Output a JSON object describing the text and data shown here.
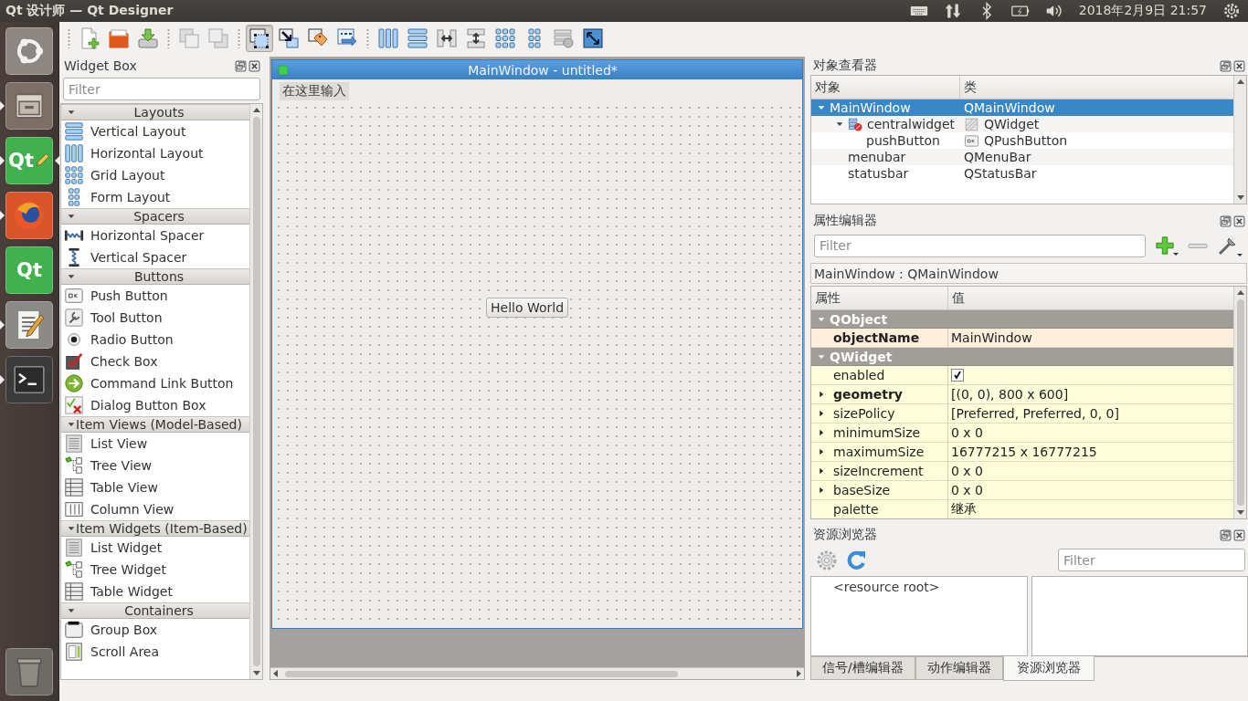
{
  "top_bar": {
    "title": "Qt 设计师 — Qt Designer",
    "clock": "2018年2月9日 21:57"
  },
  "launcher": [
    {
      "kind": "ubuntu",
      "running": false,
      "active": false
    },
    {
      "kind": "files",
      "running": true,
      "active": false
    },
    {
      "kind": "qt-designer",
      "label": "Qt",
      "running": true,
      "active": true
    },
    {
      "kind": "browser",
      "running": true,
      "active": false
    },
    {
      "kind": "qt-creator",
      "label": "Qt",
      "running": false,
      "active": false
    },
    {
      "kind": "editor",
      "running": true,
      "active": false
    },
    {
      "kind": "terminal",
      "running": true,
      "active": false
    },
    {
      "kind": "trash",
      "running": false,
      "active": false
    }
  ],
  "toolbar": {
    "groups": [
      {
        "tools": [
          {
            "kind": "new",
            "selected": false
          },
          {
            "kind": "open",
            "selected": false
          },
          {
            "kind": "save",
            "selected": false
          }
        ]
      },
      {
        "tools": [
          {
            "kind": "back",
            "selected": false
          },
          {
            "kind": "front",
            "selected": false
          }
        ]
      },
      {
        "tools": [
          {
            "kind": "select",
            "selected": true
          },
          {
            "kind": "signals",
            "selected": false
          },
          {
            "kind": "buddies",
            "selected": false
          },
          {
            "kind": "taborder",
            "selected": false
          }
        ]
      },
      {
        "tools": [
          {
            "kind": "hlayout",
            "selected": false
          },
          {
            "kind": "vlayout",
            "selected": false
          },
          {
            "kind": "hsplit",
            "selected": false
          },
          {
            "kind": "vsplit",
            "selected": false
          },
          {
            "kind": "grid",
            "selected": false
          },
          {
            "kind": "form",
            "selected": false
          },
          {
            "kind": "break",
            "selected": false
          },
          {
            "kind": "adjust",
            "selected": false
          }
        ]
      }
    ]
  },
  "widget_box": {
    "title": "Widget Box",
    "filter": {
      "placeholder": "Filter"
    },
    "categories": [
      {
        "name": "Layouts",
        "expanded": true,
        "items": [
          {
            "label": "Vertical Layout",
            "kind": "vlayout"
          },
          {
            "label": "Horizontal Layout",
            "kind": "hlayout"
          },
          {
            "label": "Grid Layout",
            "kind": "grid"
          },
          {
            "label": "Form Layout",
            "kind": "form"
          }
        ]
      },
      {
        "name": "Spacers",
        "expanded": true,
        "items": [
          {
            "label": "Horizontal Spacer",
            "kind": "hspacer"
          },
          {
            "label": "Vertical Spacer",
            "kind": "vspacer"
          }
        ]
      },
      {
        "name": "Buttons",
        "expanded": true,
        "items": [
          {
            "label": "Push Button",
            "kind": "push"
          },
          {
            "label": "Tool Button",
            "kind": "tool"
          },
          {
            "label": "Radio Button",
            "kind": "radio"
          },
          {
            "label": "Check Box",
            "kind": "check"
          },
          {
            "label": "Command Link Button",
            "kind": "command"
          },
          {
            "label": "Dialog Button Box",
            "kind": "dialog"
          }
        ]
      },
      {
        "name": "Item Views (Model-Based)",
        "expanded": true,
        "items": [
          {
            "label": "List View",
            "kind": "list"
          },
          {
            "label": "Tree View",
            "kind": "tree"
          },
          {
            "label": "Table View",
            "kind": "table"
          },
          {
            "label": "Column View",
            "kind": "column"
          }
        ]
      },
      {
        "name": "Item Widgets (Item-Based)",
        "expanded": true,
        "items": [
          {
            "label": "List Widget",
            "kind": "list"
          },
          {
            "label": "Tree Widget",
            "kind": "tree"
          },
          {
            "label": "Table Widget",
            "kind": "table"
          }
        ]
      },
      {
        "name": "Containers",
        "expanded": true,
        "items": [
          {
            "label": "Group Box",
            "kind": "group"
          },
          {
            "label": "Scroll Area",
            "kind": "scroll"
          }
        ]
      }
    ]
  },
  "form": {
    "title": "MainWindow - untitled*",
    "menu_placeholder": "在这里输入",
    "button": "Hello World"
  },
  "object_inspector": {
    "title": "对象查看器",
    "columns": [
      "对象",
      "类"
    ],
    "tree": [
      {
        "object": "MainWindow",
        "class": "QMainWindow",
        "selected": true,
        "expanded": true,
        "children": [
          {
            "object": "centralwidget",
            "class": "QWidget",
            "kind": "container",
            "selected": false,
            "expanded": true,
            "children": [
              {
                "object": "pushButton",
                "class": "QPushButton",
                "kind": "button",
                "selected": false
              }
            ]
          },
          {
            "object": "menubar",
            "class": "QMenuBar",
            "selected": false
          },
          {
            "object": "statusbar",
            "class": "QStatusBar",
            "selected": false
          }
        ]
      }
    ]
  },
  "property_editor": {
    "title": "属性编辑器",
    "filter": {
      "placeholder": "Filter"
    },
    "object_label": "MainWindow : QMainWindow",
    "columns": [
      "属性",
      "值"
    ],
    "groups": [
      {
        "name": "QObject",
        "color": "#fdefdc",
        "expanded": true,
        "properties": [
          {
            "name": "objectName",
            "kind": "text",
            "value": "MainWindow",
            "modified": true
          }
        ]
      },
      {
        "name": "QWidget",
        "color": "#fffedb",
        "expanded": true,
        "properties": [
          {
            "name": "enabled",
            "kind": "checkbox",
            "checked": true,
            "modified": false
          },
          {
            "name": "geometry",
            "kind": "compound",
            "value": "[(0, 0), 800 x 600]",
            "expanded": false,
            "modified": true
          },
          {
            "name": "sizePolicy",
            "kind": "compound",
            "value": "[Preferred, Preferred, 0, 0]",
            "expanded": false,
            "modified": false
          },
          {
            "name": "minimumSize",
            "kind": "compound",
            "value": "0 x 0",
            "expanded": false,
            "modified": false
          },
          {
            "name": "maximumSize",
            "kind": "compound",
            "value": "16777215 x 16777215",
            "expanded": false,
            "modified": false
          },
          {
            "name": "sizeIncrement",
            "kind": "compound",
            "value": "0 x 0",
            "expanded": false,
            "modified": false
          },
          {
            "name": "baseSize",
            "kind": "compound",
            "value": "0 x 0",
            "expanded": false,
            "modified": false
          },
          {
            "name": "palette",
            "kind": "text",
            "value": "继承",
            "modified": false
          }
        ]
      }
    ]
  },
  "resource_browser": {
    "title": "资源浏览器",
    "filter": {
      "placeholder": "Filter"
    },
    "root": "<resource root>"
  },
  "bottom_tabs": [
    {
      "label": "信号/槽编辑器",
      "selected": false
    },
    {
      "label": "动作编辑器",
      "selected": false
    },
    {
      "label": "资源浏览器",
      "selected": true
    }
  ]
}
